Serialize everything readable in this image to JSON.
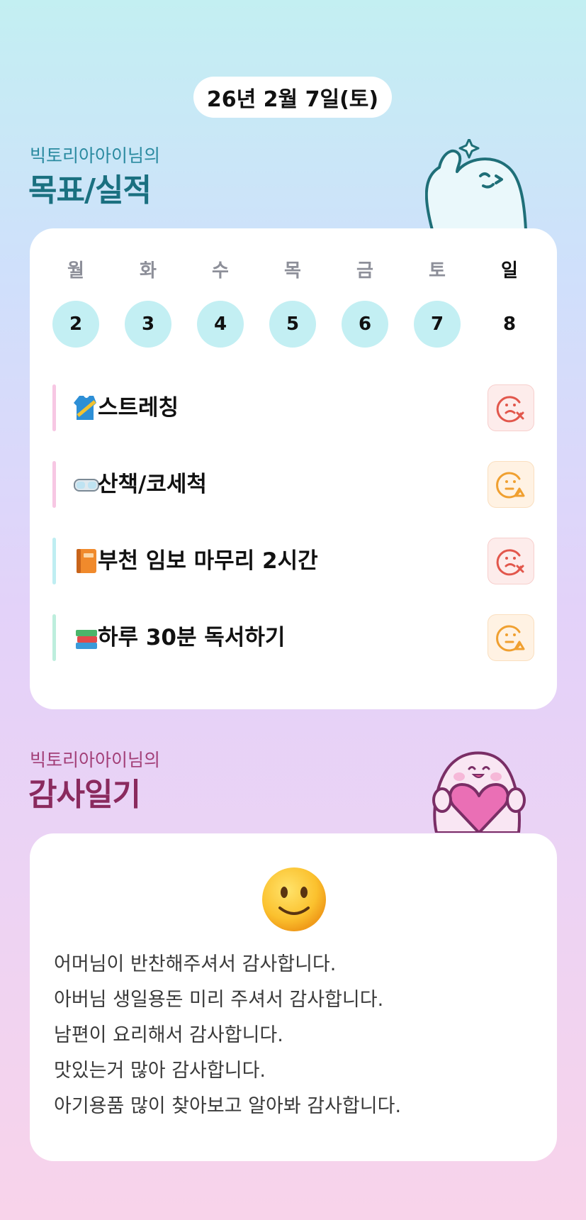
{
  "date_label": "26년 2월 7일(토)",
  "goals_section": {
    "subtitle": "빅토리아아이님의",
    "title": "목표/실적",
    "title_color": "#1a7080",
    "subtitle_color": "#2a8aa0"
  },
  "week": [
    {
      "day": "월",
      "date": "2",
      "done": true
    },
    {
      "day": "화",
      "date": "3",
      "done": true
    },
    {
      "day": "수",
      "date": "4",
      "done": true
    },
    {
      "day": "목",
      "date": "5",
      "done": true
    },
    {
      "day": "금",
      "date": "6",
      "done": true
    },
    {
      "day": "토",
      "date": "7",
      "done": true
    },
    {
      "day": "일",
      "date": "8",
      "done": false
    }
  ],
  "goals": [
    {
      "emoji": "running-shirt",
      "label": "스트레칭",
      "bar_color": "#f7c7e3",
      "status": "fail"
    },
    {
      "emoji": "goggles",
      "label": "산책/코세척",
      "bar_color": "#f7c7e3",
      "status": "partial"
    },
    {
      "emoji": "orange-book",
      "label": "부천 임보 마무리 2시간",
      "bar_color": "#bfeef2",
      "status": "fail"
    },
    {
      "emoji": "books",
      "label": " 하루 30분 독서하기",
      "bar_color": "#bdeedd",
      "status": "partial"
    }
  ],
  "thanks_section": {
    "subtitle": "빅토리아아이님의",
    "title": "감사일기",
    "title_color": "#8a2a5e",
    "subtitle_color": "#a23e77",
    "mood_icon": "slightly-smiling-face",
    "lines": [
      "어머님이 반찬해주셔서 감사합니다.",
      "아버님 생일용돈 미리 주셔서 감사합니다.",
      "남편이 요리해서 감사합니다.",
      "맛있는거 많아 감사합니다.",
      "아기용품 많이 찾아보고 알아봐 감사합니다."
    ]
  }
}
